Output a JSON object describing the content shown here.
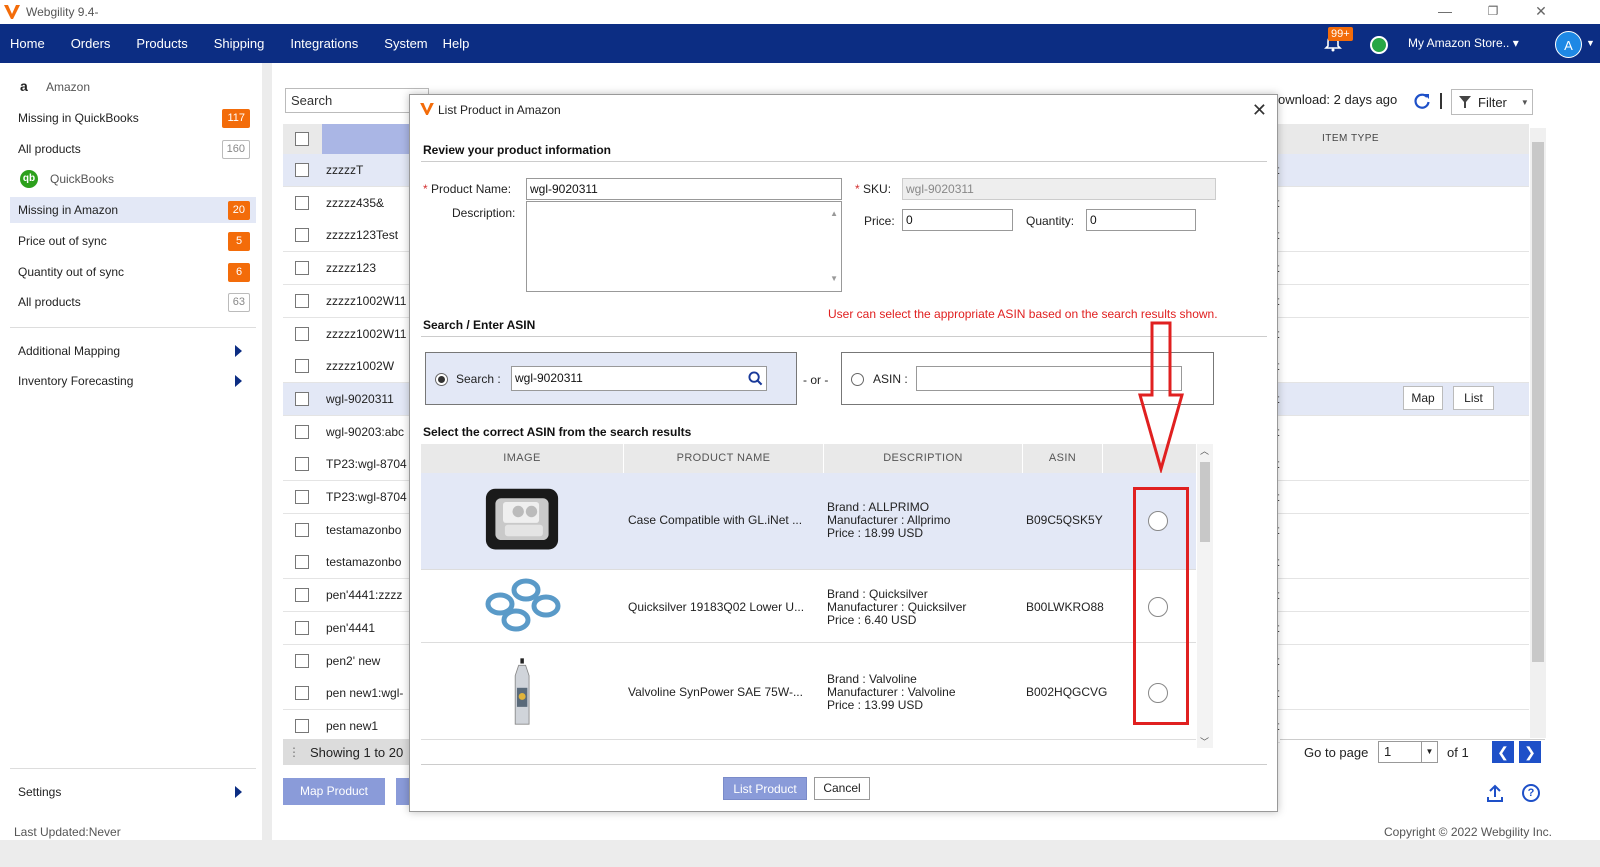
{
  "app": {
    "title": "Webgility 9.4-",
    "minimize": "—",
    "restore": "❐",
    "close": "✕"
  },
  "nav": {
    "items": [
      "Home",
      "Orders",
      "Products",
      "Shipping",
      "Integrations",
      "System",
      "Help"
    ],
    "notification_count": "99+",
    "store_label": "My Amazon Store.. ▾",
    "avatar_initial": "A"
  },
  "sidebar": {
    "amazon_header": "Amazon",
    "amazon_items": [
      {
        "label": "Missing in QuickBooks",
        "count": "117",
        "style": "orange"
      },
      {
        "label": "All products",
        "count": "160",
        "style": "grey"
      }
    ],
    "qb_header": "QuickBooks",
    "qb_items": [
      {
        "label": "Missing in Amazon",
        "count": "20",
        "style": "orange"
      },
      {
        "label": "Price out of sync",
        "count": "5",
        "style": "orange"
      },
      {
        "label": "Quantity out of sync",
        "count": "6",
        "style": "orange"
      },
      {
        "label": "All products",
        "count": "63",
        "style": "grey"
      }
    ],
    "additional_mapping": "Additional Mapping",
    "inventory_forecasting": "Inventory Forecasting",
    "settings": "Settings"
  },
  "main": {
    "search_placeholder": "Search",
    "download_text": "ownload: 2 days ago",
    "filter_label": "Filter",
    "item_type_header": "ITEM TYPE",
    "rows": [
      {
        "name": "zzzzzT",
        "frag": "t"
      },
      {
        "name": "zzzzz435&",
        "frag": "t"
      },
      {
        "name": "zzzzz123Test",
        "frag": "t"
      },
      {
        "name": "zzzzz123",
        "frag": "t"
      },
      {
        "name": "zzzzz1002W11",
        "frag": "t"
      },
      {
        "name": "zzzzz1002W11",
        "frag": "t"
      },
      {
        "name": "zzzzz1002W",
        "frag": "t"
      },
      {
        "name": "wgl-9020311",
        "frag": "t"
      },
      {
        "name": "wgl-90203:abc",
        "frag": "t"
      },
      {
        "name": "TP23:wgl-8704",
        "frag": "t"
      },
      {
        "name": "TP23:wgl-8704",
        "frag": "t"
      },
      {
        "name": "testamazonbo",
        "frag": "t"
      },
      {
        "name": "testamazonbo",
        "frag": "t"
      },
      {
        "name": "pen'4441:zzzz",
        "frag": "t"
      },
      {
        "name": "pen'4441",
        "frag": "t"
      },
      {
        "name": "pen2' new",
        "frag": "t"
      },
      {
        "name": "pen new1:wgl-",
        "frag": "t"
      },
      {
        "name": "pen new1",
        "frag": "t"
      }
    ],
    "map_btn": "Map",
    "list_btn": "List",
    "showing_text": "Showing 1 to 20",
    "go_to_page": "Go to page",
    "page_value": "1",
    "of_pages": "of 1",
    "map_product_btn": "Map Product",
    "last_updated": "Last Updated:Never",
    "copyright": "Copyright © 2022 Webgility Inc."
  },
  "modal": {
    "title": "List Product in Amazon",
    "review_title": "Review your product information",
    "product_name_label": "Product Name:",
    "product_name_value": "wgl-9020311",
    "description_label": "Description:",
    "sku_label": "SKU:",
    "sku_value": "wgl-9020311",
    "price_label": "Price:",
    "price_value": "0",
    "quantity_label": "Quantity:",
    "quantity_value": "0",
    "search_section_title": "Search / Enter ASIN",
    "note": "User can select the appropriate ASIN based on the search results shown.",
    "search_label": "Search :",
    "search_value": "wgl-9020311",
    "or_text": "- or -",
    "asin_label": "ASIN :",
    "results_title": "Select the correct ASIN from the search results",
    "columns": [
      "IMAGE",
      "PRODUCT NAME",
      "DESCRIPTION",
      "ASIN"
    ],
    "results": [
      {
        "name": "Case Compatible with GL.iNet ...",
        "brand": "Brand : ALLPRIMO",
        "manufacturer": "Manufacturer : Allprimo",
        "price": "Price : 18.99 USD",
        "asin": "B09C5QSK5Y",
        "image": "black-case-image"
      },
      {
        "name": "Quicksilver 19183Q02 Lower U...",
        "brand": "Brand : Quicksilver",
        "manufacturer": "Manufacturer : Quicksilver",
        "price": "Price : 6.40 USD",
        "asin": "B00LWKRO88",
        "image": "o-rings-image"
      },
      {
        "name": "Valvoline SynPower SAE 75W-...",
        "brand": "Brand : Valvoline",
        "manufacturer": "Manufacturer : Valvoline",
        "price": "Price : 13.99 USD",
        "asin": "B002HQGCVG",
        "image": "oil-bottle-image"
      }
    ],
    "list_product_btn": "List Product",
    "cancel_btn": "Cancel"
  },
  "colors": {
    "nav_bg": "#0c2d83",
    "accent": "#1e50c8",
    "badge_orange": "#f36c0a",
    "highlight": "#e3e8f6",
    "annotation_red": "#e02020"
  }
}
